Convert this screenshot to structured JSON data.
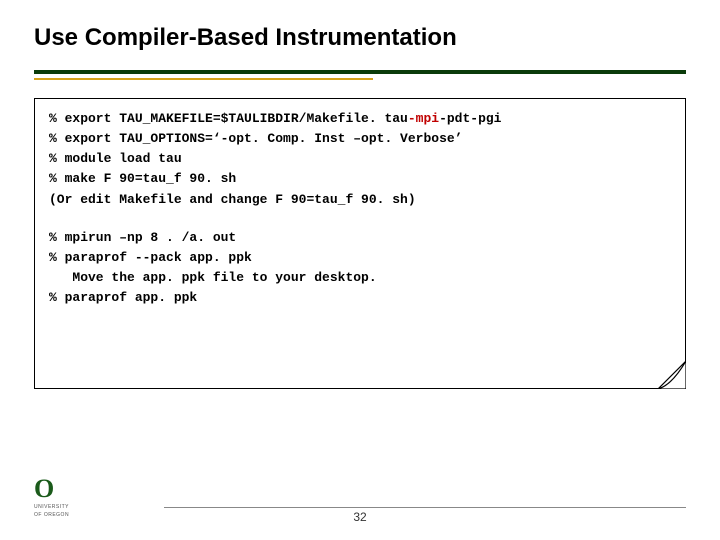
{
  "title": "Use Compiler-Based Instrumentation",
  "code": {
    "l1a": "% export TAU_MAKEFILE=$TAULIBDIR/Makefile. tau",
    "l1b": "-mpi",
    "l1c": "-pdt-pgi",
    "l2": "% export TAU_OPTIONS=‘-opt. Comp. Inst –opt. Verbose’",
    "l3": "% module load tau",
    "l4": "% make F 90=tau_f 90. sh",
    "l5": "(Or edit Makefile and change F 90=tau_f 90. sh)",
    "l6": "% mpirun –np 8 . /a. out",
    "l7": "% paraprof --pack app. ppk",
    "l8": "   Move the app. ppk file to your desktop.",
    "l9": "% paraprof app. ppk"
  },
  "page_number": "32",
  "logo": {
    "mark": "O",
    "line1": "UNIVERSITY",
    "line2": "OF OREGON"
  }
}
